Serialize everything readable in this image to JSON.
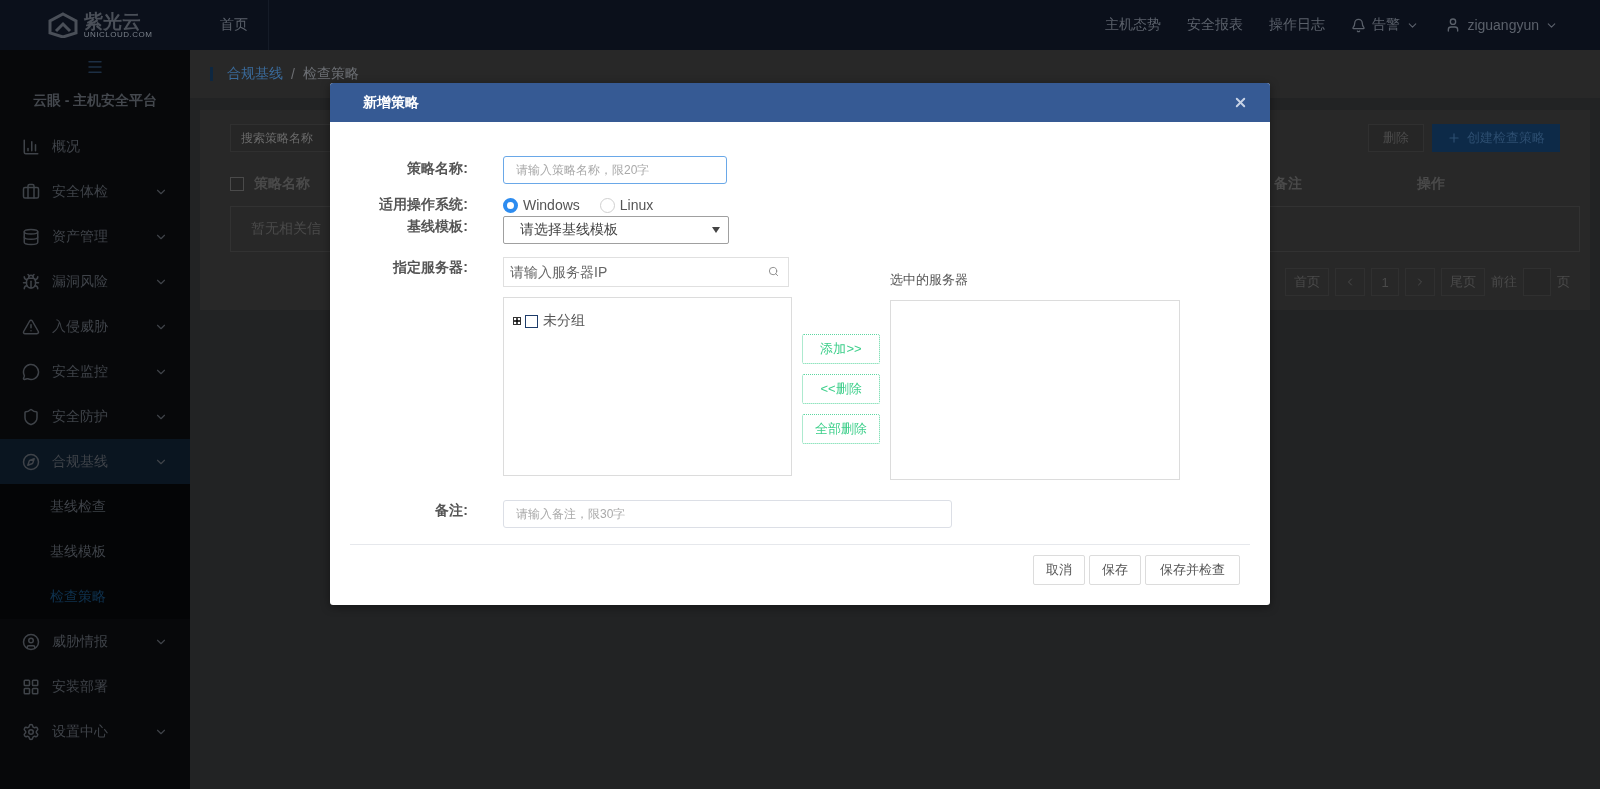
{
  "header": {
    "logo_text": "紫光云",
    "logo_subtext": "UNICLOUD.COM",
    "nav": [
      {
        "label": "首页",
        "selected": false
      }
    ],
    "links": [
      "主机态势",
      "安全报表",
      "操作日志"
    ],
    "alert": "告警",
    "user": "ziguangyun"
  },
  "sidebar": {
    "title": "云眼 - 主机安全平台",
    "items": [
      {
        "label": "概况",
        "selected": false,
        "expandable": false
      },
      {
        "label": "安全体检",
        "selected": false,
        "expandable": true
      },
      {
        "label": "资产管理",
        "selected": false,
        "expandable": true
      },
      {
        "label": "漏洞风险",
        "selected": false,
        "expandable": true
      },
      {
        "label": "入侵威胁",
        "selected": false,
        "expandable": true
      },
      {
        "label": "安全监控",
        "selected": false,
        "expandable": true
      },
      {
        "label": "安全防护",
        "selected": false,
        "expandable": true
      },
      {
        "label": "合规基线",
        "selected": true,
        "expandable": true,
        "children": [
          {
            "label": "基线检查",
            "selected": false
          },
          {
            "label": "基线模板",
            "selected": false
          },
          {
            "label": "检查策略",
            "selected": true
          }
        ]
      },
      {
        "label": "威胁情报",
        "selected": false,
        "expandable": true
      },
      {
        "label": "安装部署",
        "selected": false,
        "expandable": false
      },
      {
        "label": "设置中心",
        "selected": false,
        "expandable": true
      }
    ]
  },
  "breadcrumb": [
    "合规基线",
    "检查策略"
  ],
  "breadcrumb_separator": "/",
  "toolbar": {
    "search_placeholder": "搜索策略名称",
    "buttons": [
      {
        "label": "删除",
        "kind": "plain"
      },
      {
        "label": "创建检查策略",
        "kind": "primary"
      }
    ]
  },
  "table": {
    "select_all_checked": false,
    "columns": [
      "策略名称",
      "备注",
      "操作"
    ],
    "empty_text": "暂无相关信"
  },
  "pagination": {
    "first": "首页",
    "page": "1",
    "last": "尾页",
    "goto": "前往",
    "suffix": "页"
  },
  "modal": {
    "title": "新增策略",
    "name": {
      "label": "策略名称:",
      "placeholder": "请输入策略名称，限20字"
    },
    "os": {
      "label": "适用操作系统:",
      "options": [
        {
          "label": "Windows",
          "selected": true
        },
        {
          "label": "Linux",
          "selected": false
        }
      ]
    },
    "template": {
      "label": "基线模板:",
      "value": "请选择基线模板"
    },
    "servers": {
      "label": "指定服务器:",
      "search_placeholder": "请输入服务器IP",
      "tree": [
        {
          "label": "未分组",
          "checked": false,
          "expanded": false
        }
      ],
      "actions": [
        "添加>>",
        "<<删除",
        "全部删除"
      ],
      "selected_label": "选中的服务器"
    },
    "remark": {
      "label": "备注:",
      "placeholder": "请输入备注，限30字"
    },
    "buttons": [
      "取消",
      "保存",
      "保存并检查"
    ]
  }
}
